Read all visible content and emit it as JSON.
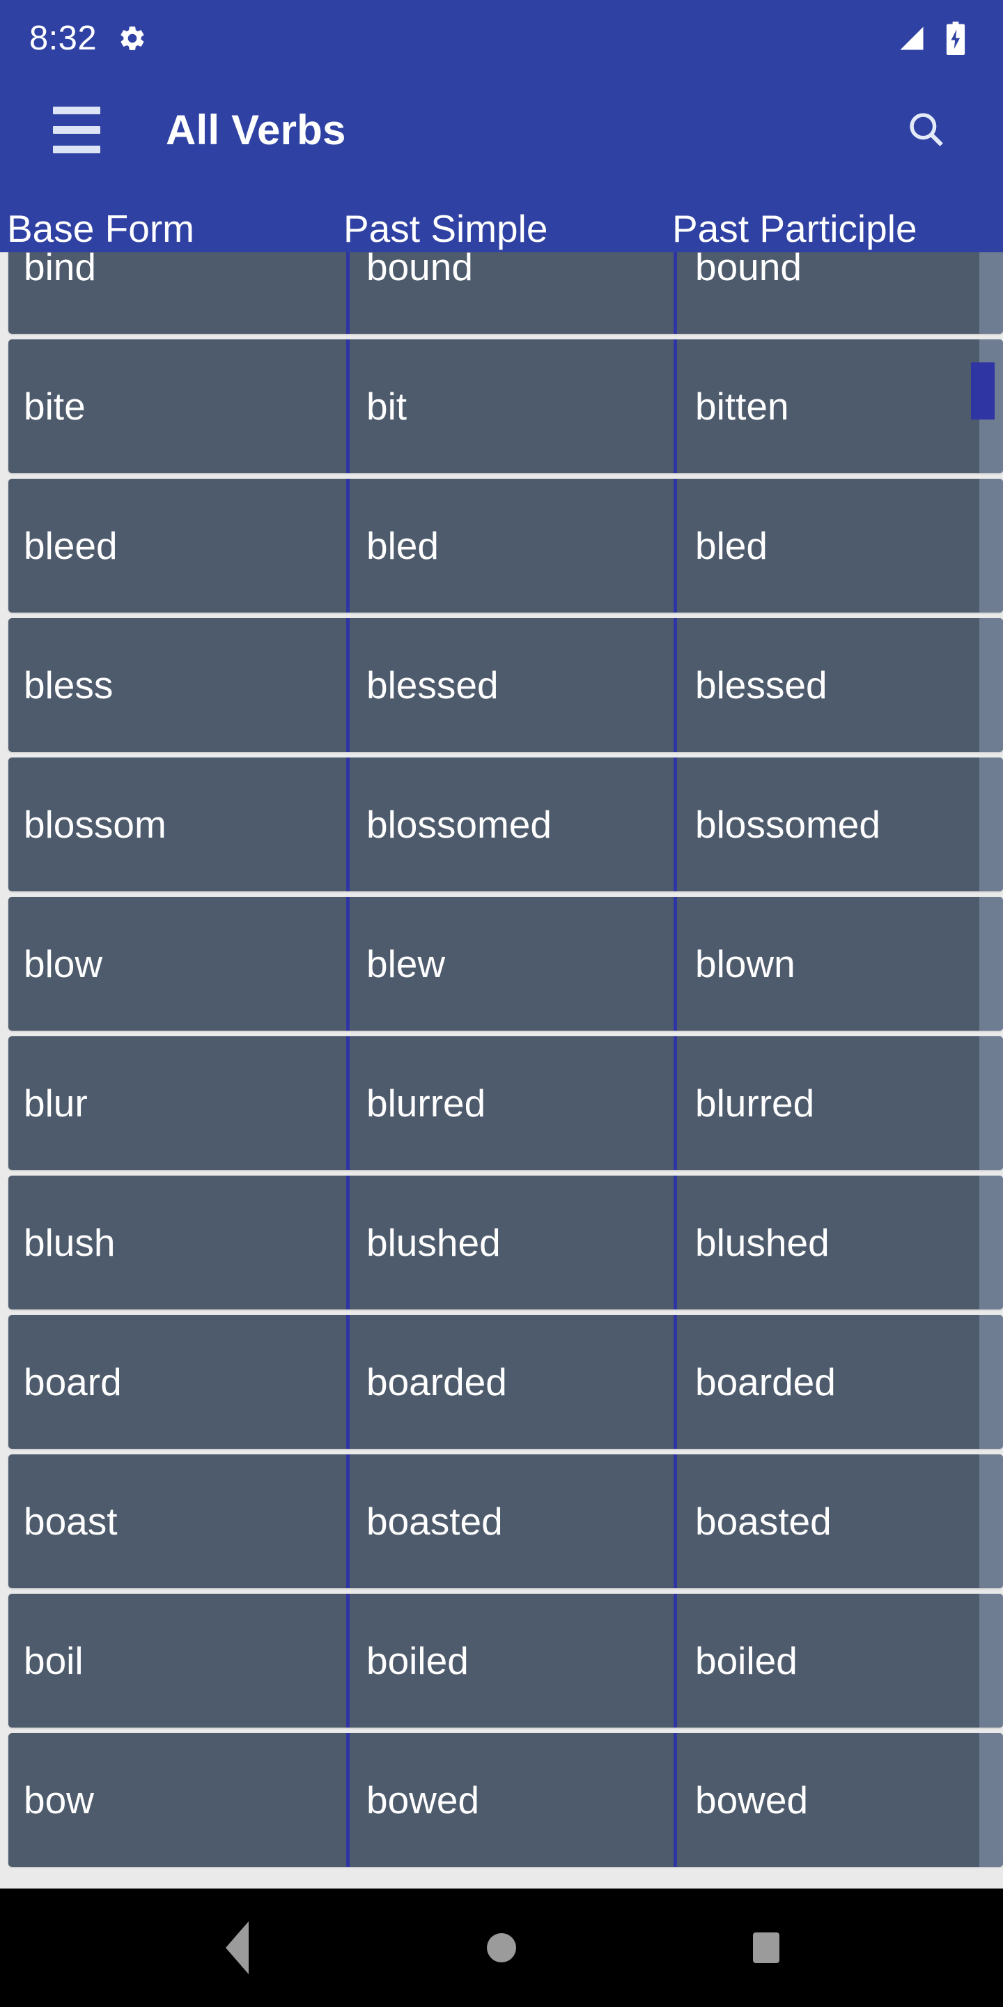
{
  "status_bar": {
    "time": "8:32",
    "gear_icon": "gear-icon",
    "signal_icon": "signal-triangle-icon",
    "battery_icon": "battery-charging-icon"
  },
  "toolbar": {
    "menu_icon": "hamburger-menu-icon",
    "title": "All Verbs",
    "search_icon": "search-icon"
  },
  "table": {
    "columns": [
      "Base Form",
      "Past Simple",
      "Past Participle"
    ],
    "rows": [
      [
        "bind",
        "bound",
        "bound"
      ],
      [
        "bite",
        "bit",
        "bitten"
      ],
      [
        "bleed",
        "bled",
        "bled"
      ],
      [
        "bless",
        "blessed",
        "blessed"
      ],
      [
        "blossom",
        "blossomed",
        "blossomed"
      ],
      [
        "blow",
        "blew",
        "blown"
      ],
      [
        "blur",
        "blurred",
        "blurred"
      ],
      [
        "blush",
        "blushed",
        "blushed"
      ],
      [
        "board",
        "boarded",
        "boarded"
      ],
      [
        "boast",
        "boasted",
        "boasted"
      ],
      [
        "boil",
        "boiled",
        "boiled"
      ],
      [
        "bow",
        "bowed",
        "bowed"
      ]
    ]
  },
  "scrollbar": {
    "thumb_color": "#2f35a3",
    "track_color": "#6e7d92"
  },
  "nav_bar": {
    "back_icon": "back-triangle-icon",
    "home_icon": "home-circle-icon",
    "recents_icon": "recents-square-icon"
  },
  "colors": {
    "primary": "#2f41a3",
    "row_bg": "#4e5b6c",
    "page_bg": "#eaeaea",
    "divider": "#2f35a3",
    "text": "#ffffff"
  }
}
